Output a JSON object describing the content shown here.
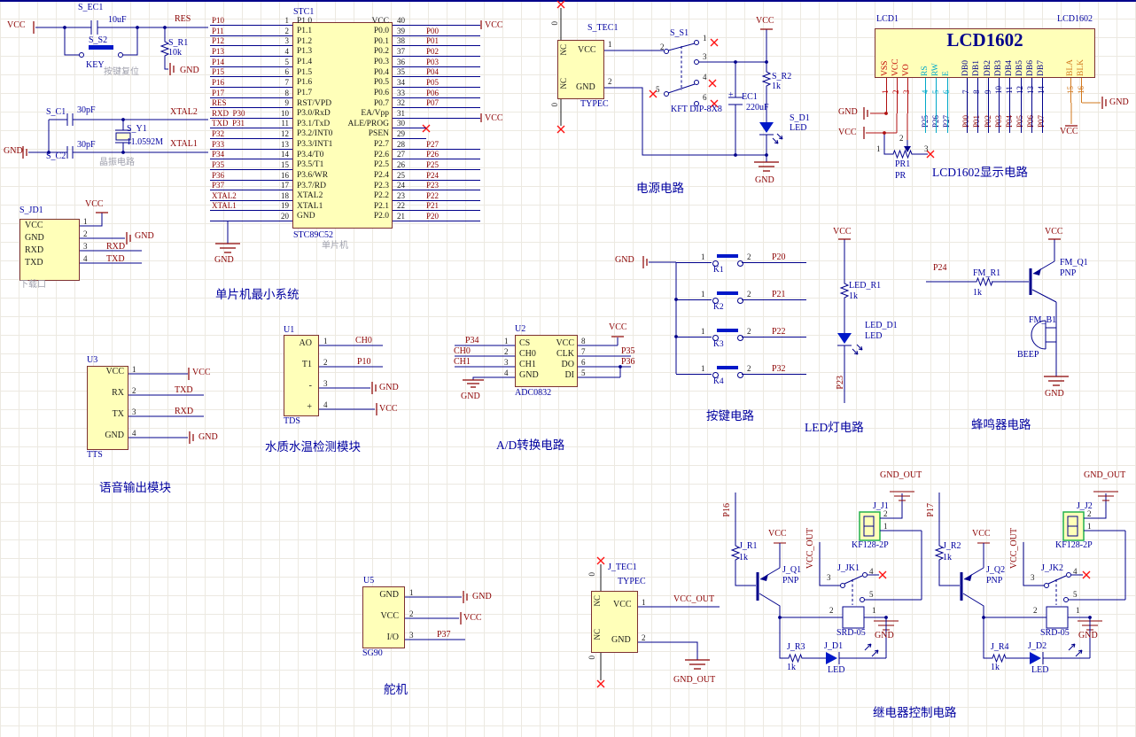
{
  "colors": {
    "wire": "#00008B",
    "net_label": "#8B0000",
    "designator": "#0000A0",
    "part_fill": "#FFFFB9",
    "part_border": "#7D3131",
    "red_x": "#FF1010",
    "lcd_power_pin": "#C00000",
    "lcd_ctrl_pin": "#00A8C8",
    "lcd_data_pin": "#00008B",
    "lcd_backlight_pin": "#D2781E",
    "terminal_border_green": "#22B14C"
  },
  "reset": {
    "vcc": "VCC",
    "cap_ref": "S_EC1",
    "cap_val": "10uF",
    "sw_ref": "S_S2",
    "sw_val": "KEY",
    "note": "按键复位",
    "res_net": "RES",
    "r_ref": "S_R1",
    "r_val": "10k",
    "gnd": "GND"
  },
  "crystal": {
    "c1_ref": "S_C1",
    "c1_val": "30pF",
    "c2_ref": "S_C2",
    "c2_val": "30pF",
    "y_ref": "S_Y1",
    "y_val": "11.0592M",
    "xtal2": "XTAL2",
    "xtal1": "XTAL1",
    "gnd": "GND",
    "caption": "晶振电路"
  },
  "download": {
    "ref": "S_JD1",
    "caption": "下载口",
    "vcc": "VCC",
    "gnd": "GND",
    "rxd": "RXD",
    "txd": "TXD",
    "names": [
      "VCC",
      "GND",
      "RXD",
      "TXD"
    ],
    "nums": [
      "1",
      "2",
      "3",
      "4"
    ]
  },
  "mcu": {
    "ref": "STC1",
    "part": "STC89C52",
    "sub": "单片机",
    "caption": "单片机最小系统",
    "gnd": "GND",
    "vcc_top": "VCC",
    "vcc_mid": "VCC",
    "left_pins": [
      {
        "num": "1",
        "name": "P1.0",
        "net": "P10"
      },
      {
        "num": "2",
        "name": "P1.1",
        "net": "P11"
      },
      {
        "num": "3",
        "name": "P1.2",
        "net": "P12"
      },
      {
        "num": "4",
        "name": "P1.3",
        "net": "P13"
      },
      {
        "num": "5",
        "name": "P1.4",
        "net": "P14"
      },
      {
        "num": "6",
        "name": "P1.5",
        "net": "P15"
      },
      {
        "num": "7",
        "name": "P1.6",
        "net": "P16"
      },
      {
        "num": "8",
        "name": "P1.7",
        "net": "P17"
      },
      {
        "num": "9",
        "name": "RST/VPD",
        "net": "RES"
      },
      {
        "num": "10",
        "name": "P3.0/RxD",
        "net": "RXD  P30"
      },
      {
        "num": "11",
        "name": "P3.1/TxD",
        "net": "TXD  P31"
      },
      {
        "num": "12",
        "name": "P3.2/INT0",
        "net": "P32"
      },
      {
        "num": "13",
        "name": "P3.3/INT1",
        "net": "P33"
      },
      {
        "num": "14",
        "name": "P3.4/T0",
        "net": "P34"
      },
      {
        "num": "15",
        "name": "P3.5/T1",
        "net": "P35"
      },
      {
        "num": "16",
        "name": "P3.6/WR",
        "net": "P36"
      },
      {
        "num": "17",
        "name": "P3.7/RD",
        "net": "P37"
      },
      {
        "num": "18",
        "name": "XTAL2",
        "net": "XTAL2"
      },
      {
        "num": "19",
        "name": "XTAL1",
        "net": "XTAL1"
      },
      {
        "num": "20",
        "name": "GND",
        "net": ""
      }
    ],
    "right_pins": [
      {
        "num": "40",
        "name": "VCC",
        "net": ""
      },
      {
        "num": "39",
        "name": "P0.0",
        "net": "P00"
      },
      {
        "num": "38",
        "name": "P0.1",
        "net": "P01"
      },
      {
        "num": "37",
        "name": "P0.2",
        "net": "P02"
      },
      {
        "num": "36",
        "name": "P0.3",
        "net": "P03"
      },
      {
        "num": "35",
        "name": "P0.4",
        "net": "P04"
      },
      {
        "num": "34",
        "name": "P0.5",
        "net": "P05"
      },
      {
        "num": "33",
        "name": "P0.6",
        "net": "P06"
      },
      {
        "num": "32",
        "name": "P0.7",
        "net": "P07"
      },
      {
        "num": "31",
        "name": "EA/Vpp",
        "net": ""
      },
      {
        "num": "30",
        "name": "ALE/PROG",
        "net": ""
      },
      {
        "num": "29",
        "name": "PSEN",
        "net": ""
      },
      {
        "num": "28",
        "name": "P2.7",
        "net": "P27"
      },
      {
        "num": "27",
        "name": "P2.6",
        "net": "P26"
      },
      {
        "num": "26",
        "name": "P2.5",
        "net": "P25"
      },
      {
        "num": "25",
        "name": "P2.4",
        "net": "P24"
      },
      {
        "num": "24",
        "name": "P2.3",
        "net": "P23"
      },
      {
        "num": "23",
        "name": "P2.2",
        "net": "P22"
      },
      {
        "num": "22",
        "name": "P2.1",
        "net": "P21"
      },
      {
        "num": "21",
        "name": "P2.0",
        "net": "P20"
      }
    ]
  },
  "power": {
    "ref": "S_TEC1",
    "type": "TYPEC",
    "nc_top": "NC",
    "nc_bot": "NC",
    "vcc_pin": "VCC",
    "gnd_pin": "GND",
    "p0_top": "0",
    "p0_bot": "0",
    "pin1": "1",
    "pin2": "2",
    "sw_ref": "S_S1",
    "sw_part": "KFT DIP-8X8",
    "sw_pins": [
      "1",
      "2",
      "3",
      "4",
      "5",
      "6"
    ],
    "cap_plus": "+",
    "cap_ref": "EC1",
    "cap_val": "220uF",
    "r_ref": "S_R2",
    "r_val": "1k",
    "led_ref": "S_D1",
    "led_val": "LED",
    "vcc": "VCC",
    "gnd": "GND",
    "caption": "电源电路"
  },
  "lcd": {
    "ref": "LCD1",
    "part": "LCD1602",
    "title": "LCD1602",
    "caption": "LCD1602显示电路",
    "power_pins": [
      {
        "name": "VSS",
        "num": "1"
      },
      {
        "name": "VCC",
        "num": "2"
      },
      {
        "name": "VO",
        "num": "3"
      }
    ],
    "ctrl_pins": [
      {
        "name": "RS",
        "num": "4",
        "net": "P25"
      },
      {
        "name": "RW",
        "num": "5",
        "net": "P26"
      },
      {
        "name": "E",
        "num": "6",
        "net": "P27"
      }
    ],
    "data_pins": [
      {
        "name": "DB0",
        "num": "7",
        "net": "P00"
      },
      {
        "name": "DB1",
        "num": "8",
        "net": "P01"
      },
      {
        "name": "DB2",
        "num": "9",
        "net": "P02"
      },
      {
        "name": "DB3",
        "num": "10",
        "net": "P03"
      },
      {
        "name": "DB4",
        "num": "11",
        "net": "P04"
      },
      {
        "name": "DB5",
        "num": "12",
        "net": "P05"
      },
      {
        "name": "DB6",
        "num": "13",
        "net": "P06"
      },
      {
        "name": "DB7",
        "num": "14",
        "net": "P07"
      }
    ],
    "bl_pins": [
      {
        "name": "BLA",
        "num": "15"
      },
      {
        "name": "BLK",
        "num": "16"
      }
    ],
    "gnd_left": "GND",
    "vcc_left": "VCC",
    "vcc_right": "VCC",
    "gnd_right": "GND",
    "pot_ref": "PR1",
    "pot_val": "PR",
    "pot_pins": [
      "1",
      "2",
      "3"
    ]
  },
  "voice": {
    "ref": "U3",
    "part": "TTS",
    "caption": "语音输出模块",
    "rows": [
      {
        "name": "VCC",
        "num": "1",
        "net": "VCC"
      },
      {
        "name": "RX",
        "num": "2",
        "net": "TXD"
      },
      {
        "name": "TX",
        "num": "3",
        "net": "RXD"
      },
      {
        "name": "GND",
        "num": "4",
        "net": "GND"
      }
    ]
  },
  "tds": {
    "ref": "U1",
    "part": "TDS",
    "caption": "水质水温检测模块",
    "rows": [
      {
        "name": "AO",
        "num": "1",
        "net": "CH0"
      },
      {
        "name": "T1",
        "num": "2",
        "net": "P10"
      },
      {
        "name": "-",
        "num": "3",
        "net": "GND"
      },
      {
        "name": "+",
        "num": "4",
        "net": "VCC"
      }
    ]
  },
  "adc": {
    "ref": "U2",
    "part": "ADC0832",
    "caption": "A/D转换电路",
    "left_rows": [
      {
        "name": "CS",
        "num": "1",
        "net": "P34"
      },
      {
        "name": "CH0",
        "num": "2",
        "net": "CH0"
      },
      {
        "name": "CH1",
        "num": "3",
        "net": "CH1"
      },
      {
        "name": "GND",
        "num": "4",
        "net": "GND"
      }
    ],
    "right_rows": [
      {
        "name": "VCC",
        "num": "8",
        "net": "VCC"
      },
      {
        "name": "CLK",
        "num": "7",
        "net": "P35"
      },
      {
        "name": "DO",
        "num": "6",
        "net": "P36"
      },
      {
        "name": "DI",
        "num": "5",
        "net": ""
      }
    ]
  },
  "keys": {
    "gnd": "GND",
    "caption": "按键电路",
    "rows": [
      {
        "n1": "1",
        "n2": "2",
        "ref": "K1",
        "net": "P20"
      },
      {
        "n1": "1",
        "n2": "2",
        "ref": "K2",
        "net": "P21"
      },
      {
        "n1": "1",
        "n2": "2",
        "ref": "K3",
        "net": "P22"
      },
      {
        "n1": "1",
        "n2": "2",
        "ref": "K4",
        "net": "P32"
      }
    ]
  },
  "led": {
    "vcc": "VCC",
    "r_ref": "LED_R1",
    "r_val": "1k",
    "d_ref": "LED_D1",
    "d_val": "LED",
    "net": "P23",
    "caption": "LED灯电路"
  },
  "buzzer": {
    "net": "P24",
    "r_ref": "FM_R1",
    "r_val": "1k",
    "q_ref": "FM_Q1",
    "q_val": "PNP",
    "vcc": "VCC",
    "b_ref": "FM_B1",
    "b_val": "BEEP",
    "gnd": "GND",
    "caption": "蜂鸣器电路"
  },
  "servo": {
    "ref": "U5",
    "part": "SG90",
    "caption": "舵机",
    "rows": [
      {
        "name": "GND",
        "num": "1",
        "net": "GND"
      },
      {
        "name": "VCC",
        "num": "2",
        "net": "VCC"
      },
      {
        "name": "I/O",
        "num": "3",
        "net": "P37"
      }
    ]
  },
  "typec_out": {
    "ref": "J_TEC1",
    "type": "TYPEC",
    "nc_top": "NC",
    "nc_bot": "NC",
    "vcc_pin": "VCC",
    "gnd_pin": "GND",
    "p0_top": "0",
    "p0_bot": "0",
    "pin1": "1",
    "pin2": "2",
    "vcc_out": "VCC_OUT",
    "gnd_out": "GND_OUT"
  },
  "relay": {
    "caption": "继电器控制电路",
    "units": [
      {
        "net": "P16",
        "r_ref": "J_R1",
        "r_val": "1k",
        "vcc": "VCC",
        "q_ref": "J_Q1",
        "q_val": "PNP",
        "vcc_out": "VCC_OUT",
        "jk_ref": "J_JK1",
        "jk3": "3",
        "jk4": "4",
        "jk5": "5",
        "j_ref": "J_J1",
        "jp2": "2",
        "jp1": "1",
        "gnd_out": "GND_OUT",
        "j_part": "KF128-2P",
        "coil": "SRD-05",
        "c2": "2",
        "c1": "1",
        "gnd": "GND",
        "r2_ref": "J_R3",
        "r2_val": "1k",
        "d_ref": "J_D1",
        "d_val": "LED"
      },
      {
        "net": "P17",
        "r_ref": "J_R2",
        "r_val": "1k",
        "vcc": "VCC",
        "q_ref": "J_Q2",
        "q_val": "PNP",
        "vcc_out": "VCC_OUT",
        "jk_ref": "J_JK2",
        "jk3": "3",
        "jk4": "4",
        "jk5": "5",
        "j_ref": "J_J2",
        "jp2": "2",
        "jp1": "1",
        "gnd_out": "GND_OUT",
        "j_part": "KF128-2P",
        "coil": "SRD-05",
        "c2": "2",
        "c1": "1",
        "gnd": "GND",
        "r2_ref": "J_R4",
        "r2_val": "1k",
        "d_ref": "J_D2",
        "d_val": "LED"
      }
    ]
  }
}
